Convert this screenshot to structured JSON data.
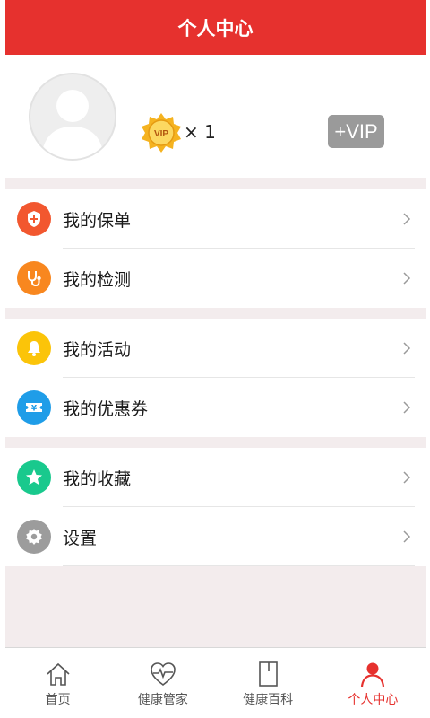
{
  "header": {
    "title": "个人中心"
  },
  "profile": {
    "vip_badge_text": "VIP",
    "vip_count": "× 1",
    "vip_button": "+VIP"
  },
  "menu": [
    {
      "label": "我的保单",
      "icon": "shield-plus-icon",
      "color": "#f2572f"
    },
    {
      "label": "我的检测",
      "icon": "stethoscope-icon",
      "color": "#f8871f"
    },
    {
      "label": "我的活动",
      "icon": "bell-icon",
      "color": "#fbc409"
    },
    {
      "label": "我的优惠券",
      "icon": "yuan-ticket-icon",
      "color": "#1f9de8"
    },
    {
      "label": "我的收藏",
      "icon": "star-icon",
      "color": "#19c98d"
    },
    {
      "label": "设置",
      "icon": "gear-icon",
      "color": "#9c9c9c"
    }
  ],
  "tabbar": [
    {
      "label": "首页",
      "icon": "home-icon"
    },
    {
      "label": "健康管家",
      "icon": "heart-pulse-icon"
    },
    {
      "label": "健康百科",
      "icon": "book-icon"
    },
    {
      "label": "个人中心",
      "icon": "person-icon",
      "active": true
    }
  ],
  "colors": {
    "primary": "#e6312e",
    "background": "#f3eced"
  }
}
